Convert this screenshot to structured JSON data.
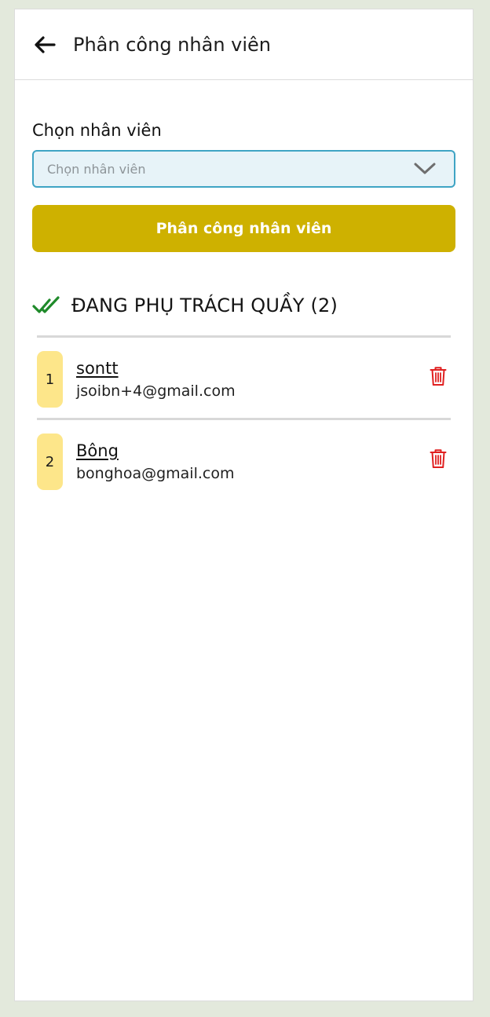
{
  "header": {
    "title": "Phân công nhân viên",
    "back_icon": "arrow-left-icon"
  },
  "form": {
    "label": "Chọn nhân viên",
    "select_placeholder": "Chọn nhân viên",
    "select_icon": "chevron-down-icon",
    "submit_label": "Phân công nhân viên"
  },
  "section": {
    "title": "ĐANG PHỤ TRÁCH QUẦY (2)",
    "icon": "double-check-icon"
  },
  "staff": [
    {
      "index": "1",
      "name": "sontt",
      "email": "jsoibn+4@gmail.com"
    },
    {
      "index": "2",
      "name": "Bông",
      "email": "bonghoa@gmail.com"
    }
  ],
  "colors": {
    "page_background": "#e3e9dc",
    "select_border": "#3fa4c4",
    "select_background": "#e7f3f8",
    "button": "#ceb100",
    "badge": "#fde68a",
    "trash": "#e02020",
    "check": "#1f8a2a"
  }
}
